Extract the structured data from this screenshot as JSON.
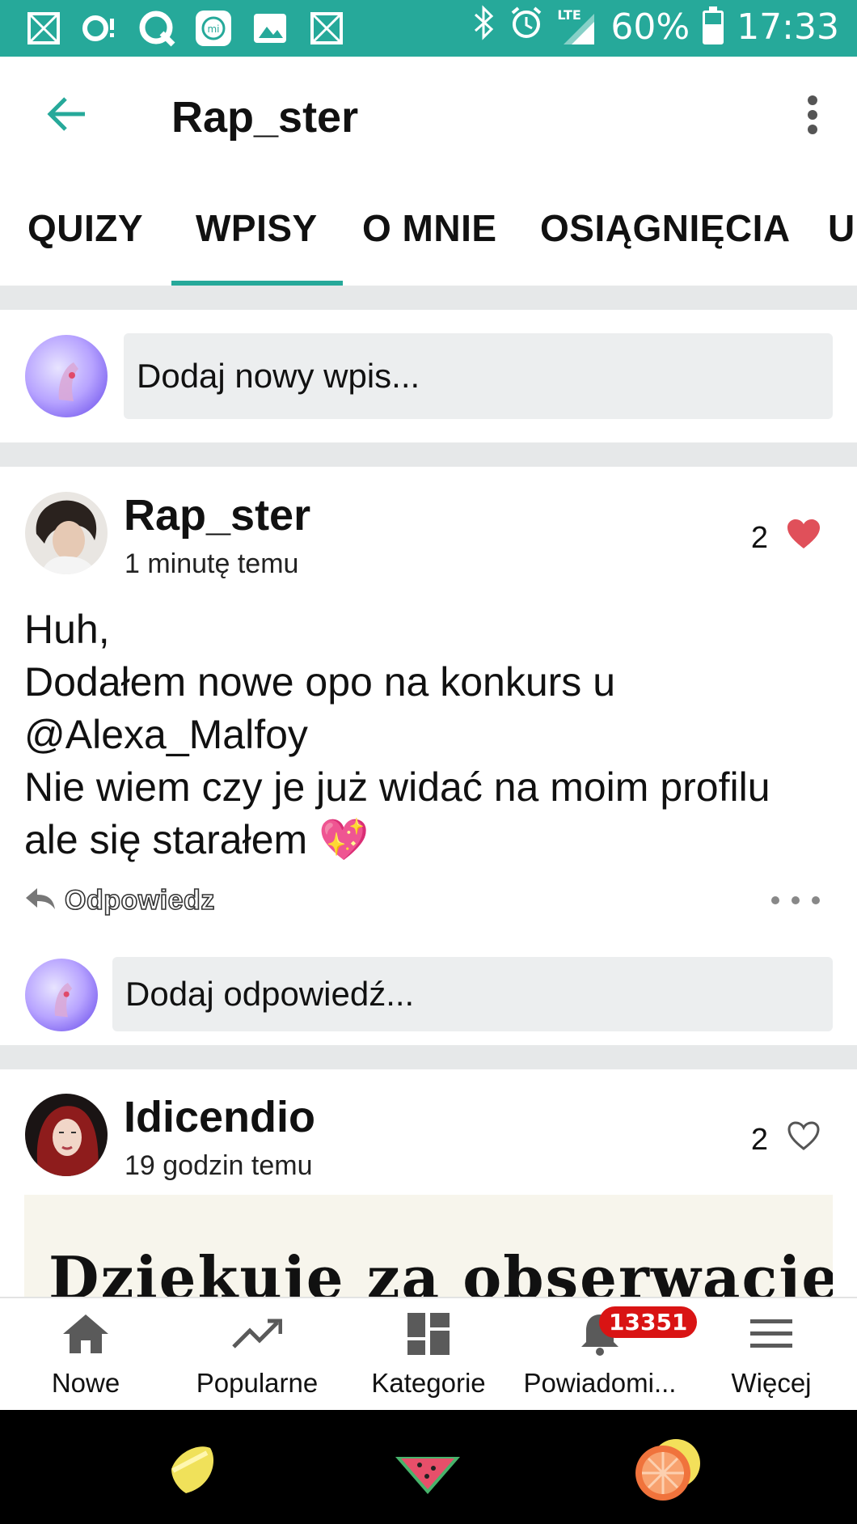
{
  "status_bar": {
    "battery": "60%",
    "battery_level": 0.6,
    "time": "17:33",
    "network": "LTE",
    "left_icons": [
      "app-notification-icon",
      "voicemail-icon",
      "q-icon",
      "mi-icon",
      "image-icon",
      "app-notification-icon"
    ],
    "right_icons": [
      "bluetooth-icon",
      "alarm-icon",
      "signal-icon",
      "battery-icon"
    ]
  },
  "header": {
    "title": "Rap_ster",
    "back_icon": "back-arrow-icon",
    "menu_icon": "more-vert-icon"
  },
  "tabs": [
    {
      "label": "QUIZY"
    },
    {
      "label": "WPISY",
      "active": true
    },
    {
      "label": "O MNIE"
    },
    {
      "label": "OSIĄGNIĘCIA"
    },
    {
      "label": "U"
    }
  ],
  "compose": {
    "placeholder": "Dodaj nowy wpis..."
  },
  "posts": [
    {
      "author": "Rap_ster",
      "time": "1 minutę temu",
      "likes": "2",
      "liked": true,
      "body_lines": [
        "Huh,",
        "Dodałem nowe opo na konkurs u",
        "@Alexa_Malfoy",
        "Nie wiem czy je już widać na moim profilu",
        "ale się starałem 💖"
      ],
      "reply_label": "Odpowiedz",
      "reply_placeholder": "Dodaj odpowiedź..."
    },
    {
      "author": "Idicendio",
      "time": "19 godzin temu",
      "likes": "2",
      "liked": false,
      "image_text": "Dziekuje za obserwacje !"
    }
  ],
  "bottom_nav": [
    {
      "label": "Nowe",
      "icon": "home-icon"
    },
    {
      "label": "Popularne",
      "icon": "trending-icon"
    },
    {
      "label": "Kategorie",
      "icon": "dashboard-icon"
    },
    {
      "label": "Powiadomi...",
      "icon": "bell-icon",
      "badge": "13351"
    },
    {
      "label": "Więcej",
      "icon": "menu-icon"
    }
  ],
  "colors": {
    "accent": "#26a99a",
    "heart": "#e0505a",
    "badge": "#d91414",
    "separator": "#e6e8e9",
    "input_bg": "#eceeef"
  }
}
